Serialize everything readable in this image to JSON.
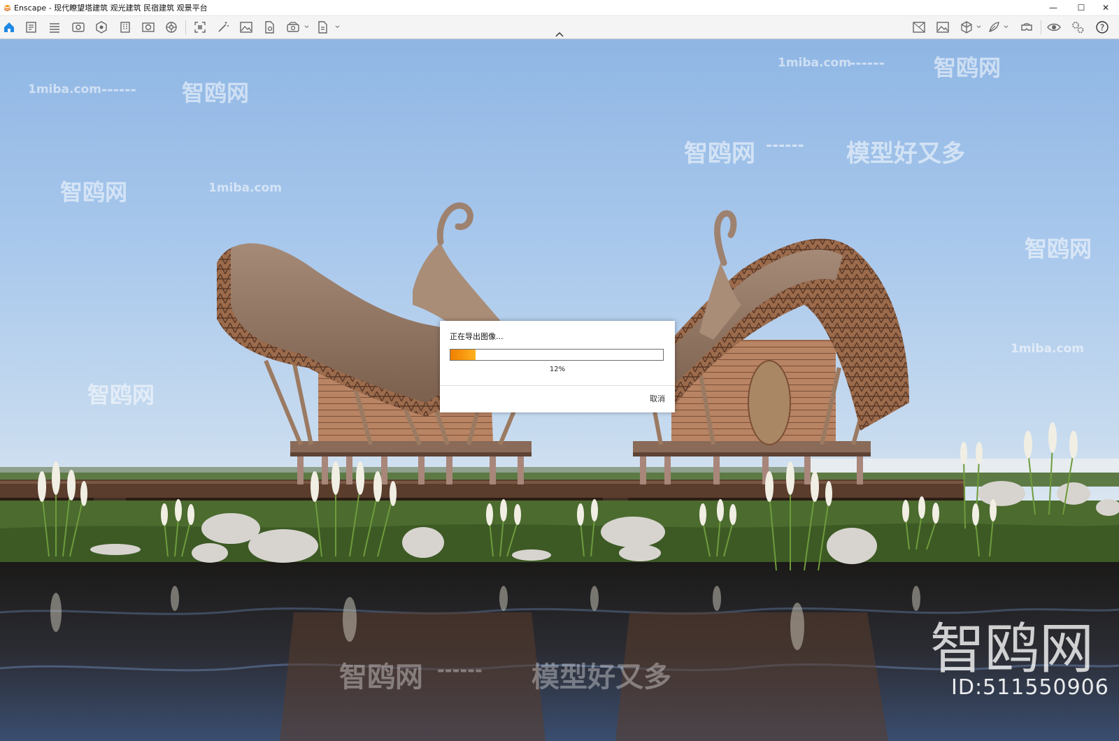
{
  "window": {
    "title": "Enscape - 现代瞭望塔建筑 观光建筑 民宿建筑 观景平台",
    "controls": {
      "minimize": "—",
      "maximize": "☐",
      "close": "✕"
    }
  },
  "toolbar": {
    "left_icons": [
      "home-icon",
      "sketch-icon",
      "bim-icon",
      "camera-view-icon",
      "asset-icon",
      "building-icon",
      "material-icon",
      "settings-wheel-icon",
      "screenshot-icon",
      "magic-wand-icon",
      "image-export-icon",
      "document-export-icon",
      "panorama-icon",
      "batch-export-icon"
    ],
    "right_icons": [
      "map-icon",
      "image-icon",
      "cube-icon",
      "feather-icon",
      "vr-headset-icon",
      "eye-icon",
      "gears-icon",
      "help-icon"
    ]
  },
  "watermarks": {
    "domain": "1miba.com",
    "brand": "智鸥网",
    "slogan": "模型好又多",
    "dashes": "------",
    "brand_big": "智鸥网",
    "id": "ID:511550906"
  },
  "dialog": {
    "title": "正在导出图像...",
    "progress_value": 0.12,
    "progress_text": "12%",
    "cancel_label": "取消"
  },
  "colors": {
    "progress_start": "#f07f00",
    "progress_end": "#ffb11e",
    "accent_blue": "#1e88e5"
  }
}
